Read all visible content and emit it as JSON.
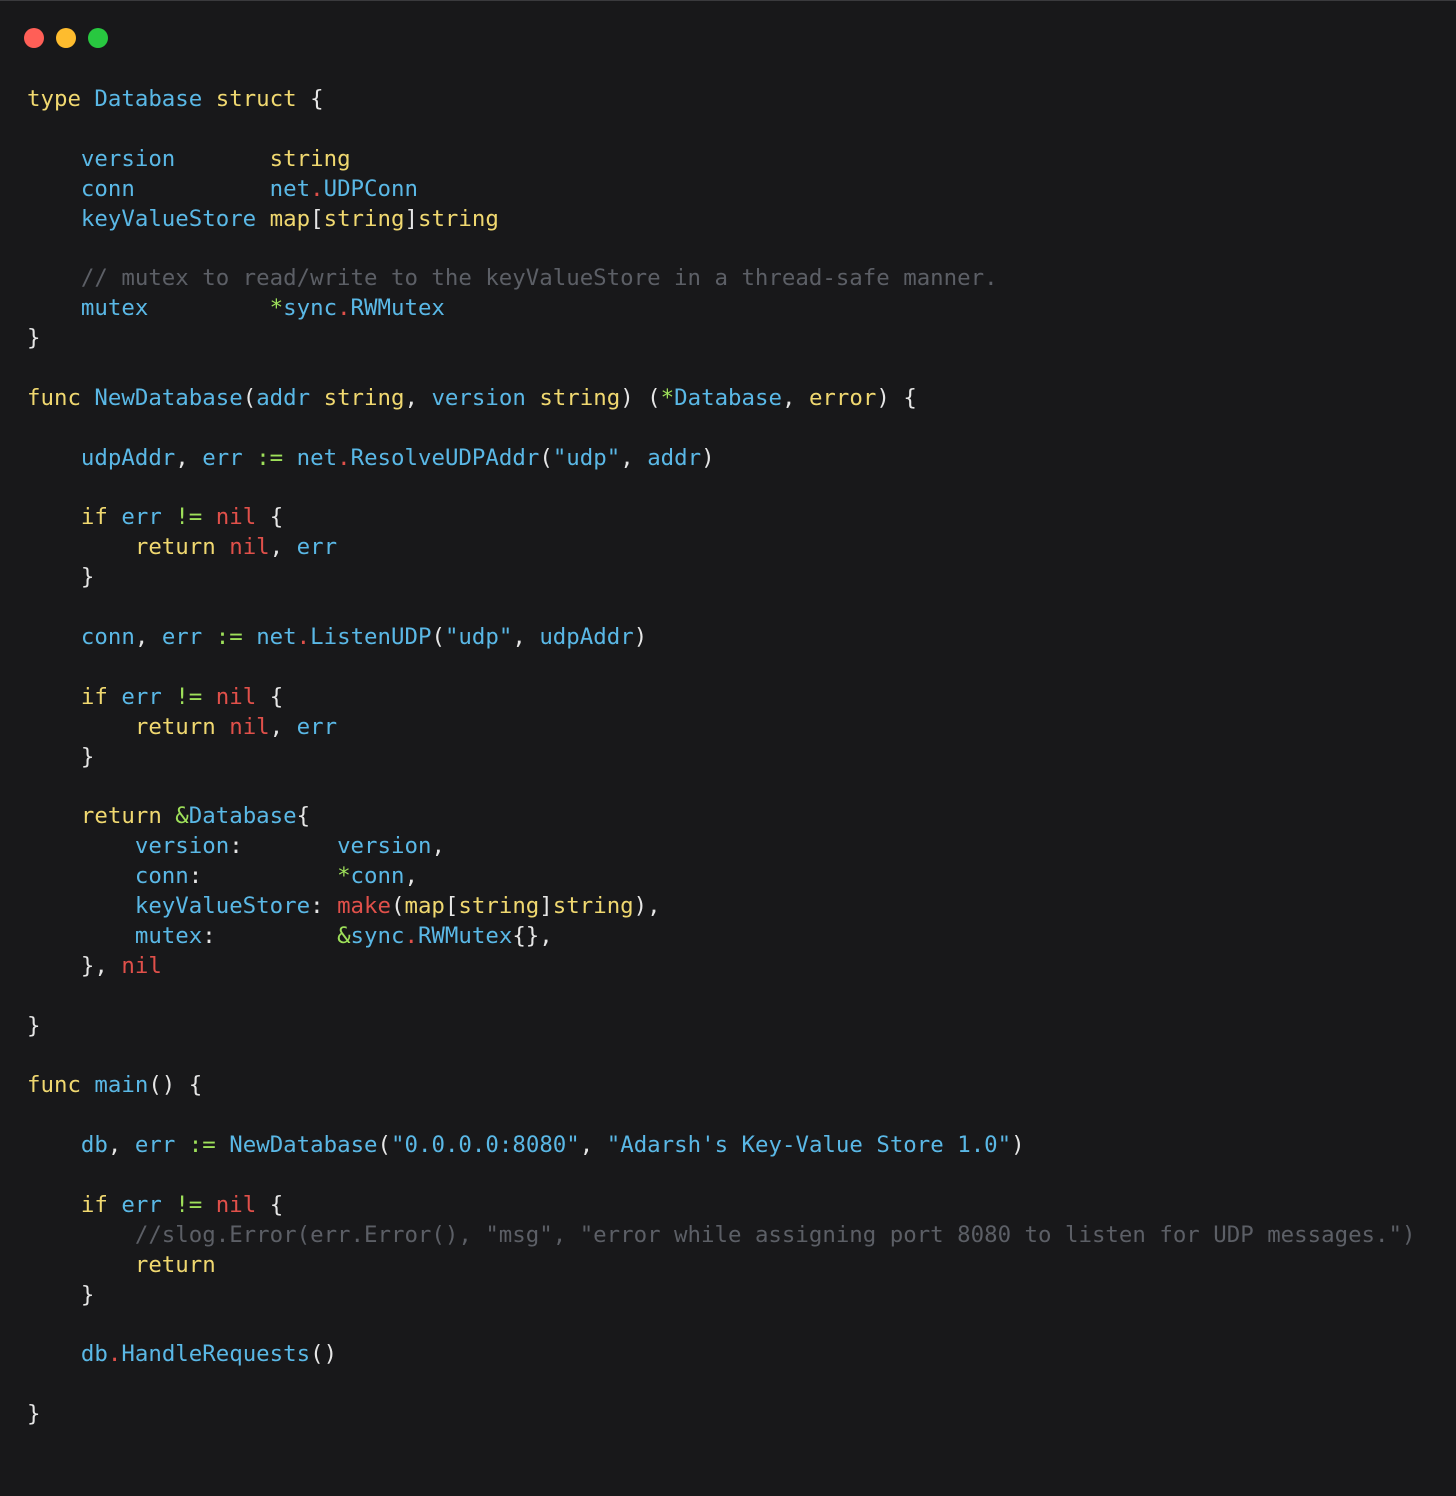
{
  "window": {
    "controls": {
      "close_color": "#ff5f57",
      "minimize_color": "#febc2e",
      "maximize_color": "#28c840"
    }
  },
  "code": {
    "language": "Go",
    "lines": [
      [
        {
          "text": "type",
          "cls": "k"
        },
        {
          "text": " ",
          "cls": "p"
        },
        {
          "text": "Database",
          "cls": "i"
        },
        {
          "text": " ",
          "cls": "p"
        },
        {
          "text": "struct",
          "cls": "k"
        },
        {
          "text": " {",
          "cls": "p"
        }
      ],
      [],
      [
        {
          "text": "    ",
          "cls": "p"
        },
        {
          "text": "version",
          "cls": "i"
        },
        {
          "text": "       ",
          "cls": "p"
        },
        {
          "text": "string",
          "cls": "t"
        }
      ],
      [
        {
          "text": "    ",
          "cls": "p"
        },
        {
          "text": "conn",
          "cls": "i"
        },
        {
          "text": "          ",
          "cls": "p"
        },
        {
          "text": "net",
          "cls": "i"
        },
        {
          "text": ".",
          "cls": "r"
        },
        {
          "text": "UDPConn",
          "cls": "i"
        }
      ],
      [
        {
          "text": "    ",
          "cls": "p"
        },
        {
          "text": "keyValueStore",
          "cls": "i"
        },
        {
          "text": " ",
          "cls": "p"
        },
        {
          "text": "map",
          "cls": "t"
        },
        {
          "text": "[",
          "cls": "p"
        },
        {
          "text": "string",
          "cls": "t"
        },
        {
          "text": "]",
          "cls": "p"
        },
        {
          "text": "string",
          "cls": "t"
        }
      ],
      [],
      [
        {
          "text": "    ",
          "cls": "p"
        },
        {
          "text": "// mutex to read/write to the keyValueStore in a thread-safe manner.",
          "cls": "c"
        }
      ],
      [
        {
          "text": "    ",
          "cls": "p"
        },
        {
          "text": "mutex",
          "cls": "i"
        },
        {
          "text": "         ",
          "cls": "p"
        },
        {
          "text": "*",
          "cls": "o"
        },
        {
          "text": "sync",
          "cls": "i"
        },
        {
          "text": ".",
          "cls": "r"
        },
        {
          "text": "RWMutex",
          "cls": "i"
        }
      ],
      [
        {
          "text": "}",
          "cls": "p"
        }
      ],
      [],
      [
        {
          "text": "func",
          "cls": "k"
        },
        {
          "text": " ",
          "cls": "p"
        },
        {
          "text": "NewDatabase",
          "cls": "i"
        },
        {
          "text": "(",
          "cls": "p"
        },
        {
          "text": "addr",
          "cls": "i"
        },
        {
          "text": " ",
          "cls": "p"
        },
        {
          "text": "string",
          "cls": "t"
        },
        {
          "text": ", ",
          "cls": "p"
        },
        {
          "text": "version",
          "cls": "i"
        },
        {
          "text": " ",
          "cls": "p"
        },
        {
          "text": "string",
          "cls": "t"
        },
        {
          "text": ") (",
          "cls": "p"
        },
        {
          "text": "*",
          "cls": "o"
        },
        {
          "text": "Database",
          "cls": "i"
        },
        {
          "text": ", ",
          "cls": "p"
        },
        {
          "text": "error",
          "cls": "t"
        },
        {
          "text": ") {",
          "cls": "p"
        }
      ],
      [],
      [
        {
          "text": "    ",
          "cls": "p"
        },
        {
          "text": "udpAddr",
          "cls": "i"
        },
        {
          "text": ", ",
          "cls": "p"
        },
        {
          "text": "err",
          "cls": "i"
        },
        {
          "text": " ",
          "cls": "p"
        },
        {
          "text": ":=",
          "cls": "o"
        },
        {
          "text": " ",
          "cls": "p"
        },
        {
          "text": "net",
          "cls": "i"
        },
        {
          "text": ".",
          "cls": "r"
        },
        {
          "text": "ResolveUDPAddr",
          "cls": "i"
        },
        {
          "text": "(",
          "cls": "p"
        },
        {
          "text": "\"udp\"",
          "cls": "s"
        },
        {
          "text": ", ",
          "cls": "p"
        },
        {
          "text": "addr",
          "cls": "i"
        },
        {
          "text": ")",
          "cls": "p"
        }
      ],
      [],
      [
        {
          "text": "    ",
          "cls": "p"
        },
        {
          "text": "if",
          "cls": "k"
        },
        {
          "text": " ",
          "cls": "p"
        },
        {
          "text": "err",
          "cls": "i"
        },
        {
          "text": " ",
          "cls": "p"
        },
        {
          "text": "!=",
          "cls": "o"
        },
        {
          "text": " ",
          "cls": "p"
        },
        {
          "text": "nil",
          "cls": "r"
        },
        {
          "text": " {",
          "cls": "p"
        }
      ],
      [
        {
          "text": "        ",
          "cls": "p"
        },
        {
          "text": "return",
          "cls": "k"
        },
        {
          "text": " ",
          "cls": "p"
        },
        {
          "text": "nil",
          "cls": "r"
        },
        {
          "text": ", ",
          "cls": "p"
        },
        {
          "text": "err",
          "cls": "i"
        }
      ],
      [
        {
          "text": "    }",
          "cls": "p"
        }
      ],
      [],
      [
        {
          "text": "    ",
          "cls": "p"
        },
        {
          "text": "conn",
          "cls": "i"
        },
        {
          "text": ", ",
          "cls": "p"
        },
        {
          "text": "err",
          "cls": "i"
        },
        {
          "text": " ",
          "cls": "p"
        },
        {
          "text": ":=",
          "cls": "o"
        },
        {
          "text": " ",
          "cls": "p"
        },
        {
          "text": "net",
          "cls": "i"
        },
        {
          "text": ".",
          "cls": "r"
        },
        {
          "text": "ListenUDP",
          "cls": "i"
        },
        {
          "text": "(",
          "cls": "p"
        },
        {
          "text": "\"udp\"",
          "cls": "s"
        },
        {
          "text": ", ",
          "cls": "p"
        },
        {
          "text": "udpAddr",
          "cls": "i"
        },
        {
          "text": ")",
          "cls": "p"
        }
      ],
      [],
      [
        {
          "text": "    ",
          "cls": "p"
        },
        {
          "text": "if",
          "cls": "k"
        },
        {
          "text": " ",
          "cls": "p"
        },
        {
          "text": "err",
          "cls": "i"
        },
        {
          "text": " ",
          "cls": "p"
        },
        {
          "text": "!=",
          "cls": "o"
        },
        {
          "text": " ",
          "cls": "p"
        },
        {
          "text": "nil",
          "cls": "r"
        },
        {
          "text": " {",
          "cls": "p"
        }
      ],
      [
        {
          "text": "        ",
          "cls": "p"
        },
        {
          "text": "return",
          "cls": "k"
        },
        {
          "text": " ",
          "cls": "p"
        },
        {
          "text": "nil",
          "cls": "r"
        },
        {
          "text": ", ",
          "cls": "p"
        },
        {
          "text": "err",
          "cls": "i"
        }
      ],
      [
        {
          "text": "    }",
          "cls": "p"
        }
      ],
      [],
      [
        {
          "text": "    ",
          "cls": "p"
        },
        {
          "text": "return",
          "cls": "k"
        },
        {
          "text": " ",
          "cls": "p"
        },
        {
          "text": "&",
          "cls": "o"
        },
        {
          "text": "Database",
          "cls": "i"
        },
        {
          "text": "{",
          "cls": "p"
        }
      ],
      [
        {
          "text": "        ",
          "cls": "p"
        },
        {
          "text": "version",
          "cls": "i"
        },
        {
          "text": ":       ",
          "cls": "p"
        },
        {
          "text": "version",
          "cls": "i"
        },
        {
          "text": ",",
          "cls": "p"
        }
      ],
      [
        {
          "text": "        ",
          "cls": "p"
        },
        {
          "text": "conn",
          "cls": "i"
        },
        {
          "text": ":          ",
          "cls": "p"
        },
        {
          "text": "*",
          "cls": "o"
        },
        {
          "text": "conn",
          "cls": "i"
        },
        {
          "text": ",",
          "cls": "p"
        }
      ],
      [
        {
          "text": "        ",
          "cls": "p"
        },
        {
          "text": "keyValueStore",
          "cls": "i"
        },
        {
          "text": ": ",
          "cls": "p"
        },
        {
          "text": "make",
          "cls": "r"
        },
        {
          "text": "(",
          "cls": "p"
        },
        {
          "text": "map",
          "cls": "t"
        },
        {
          "text": "[",
          "cls": "p"
        },
        {
          "text": "string",
          "cls": "t"
        },
        {
          "text": "]",
          "cls": "p"
        },
        {
          "text": "string",
          "cls": "t"
        },
        {
          "text": "),",
          "cls": "p"
        }
      ],
      [
        {
          "text": "        ",
          "cls": "p"
        },
        {
          "text": "mutex",
          "cls": "i"
        },
        {
          "text": ":         ",
          "cls": "p"
        },
        {
          "text": "&",
          "cls": "o"
        },
        {
          "text": "sync",
          "cls": "i"
        },
        {
          "text": ".",
          "cls": "r"
        },
        {
          "text": "RWMutex",
          "cls": "i"
        },
        {
          "text": "{},",
          "cls": "p"
        }
      ],
      [
        {
          "text": "    }, ",
          "cls": "p"
        },
        {
          "text": "nil",
          "cls": "r"
        }
      ],
      [],
      [
        {
          "text": "}",
          "cls": "p"
        }
      ],
      [],
      [
        {
          "text": "func",
          "cls": "k"
        },
        {
          "text": " ",
          "cls": "p"
        },
        {
          "text": "main",
          "cls": "i"
        },
        {
          "text": "() {",
          "cls": "p"
        }
      ],
      [],
      [
        {
          "text": "    ",
          "cls": "p"
        },
        {
          "text": "db",
          "cls": "i"
        },
        {
          "text": ", ",
          "cls": "p"
        },
        {
          "text": "err",
          "cls": "i"
        },
        {
          "text": " ",
          "cls": "p"
        },
        {
          "text": ":=",
          "cls": "o"
        },
        {
          "text": " ",
          "cls": "p"
        },
        {
          "text": "NewDatabase",
          "cls": "i"
        },
        {
          "text": "(",
          "cls": "p"
        },
        {
          "text": "\"0.0.0.0:8080\"",
          "cls": "s"
        },
        {
          "text": ", ",
          "cls": "p"
        },
        {
          "text": "\"Adarsh's Key-Value Store 1.0\"",
          "cls": "s"
        },
        {
          "text": ")",
          "cls": "p"
        }
      ],
      [],
      [
        {
          "text": "    ",
          "cls": "p"
        },
        {
          "text": "if",
          "cls": "k"
        },
        {
          "text": " ",
          "cls": "p"
        },
        {
          "text": "err",
          "cls": "i"
        },
        {
          "text": " ",
          "cls": "p"
        },
        {
          "text": "!=",
          "cls": "o"
        },
        {
          "text": " ",
          "cls": "p"
        },
        {
          "text": "nil",
          "cls": "r"
        },
        {
          "text": " {",
          "cls": "p"
        }
      ],
      [
        {
          "text": "        ",
          "cls": "p"
        },
        {
          "text": "//slog.Error(err.Error(), \"msg\", \"error while assigning port 8080 to listen for UDP messages.\")",
          "cls": "c"
        }
      ],
      [
        {
          "text": "        ",
          "cls": "p"
        },
        {
          "text": "return",
          "cls": "k"
        }
      ],
      [
        {
          "text": "    }",
          "cls": "p"
        }
      ],
      [],
      [
        {
          "text": "    ",
          "cls": "p"
        },
        {
          "text": "db",
          "cls": "i"
        },
        {
          "text": ".",
          "cls": "r"
        },
        {
          "text": "HandleRequests",
          "cls": "i"
        },
        {
          "text": "()",
          "cls": "p"
        }
      ],
      [],
      [
        {
          "text": "}",
          "cls": "p"
        }
      ]
    ]
  }
}
